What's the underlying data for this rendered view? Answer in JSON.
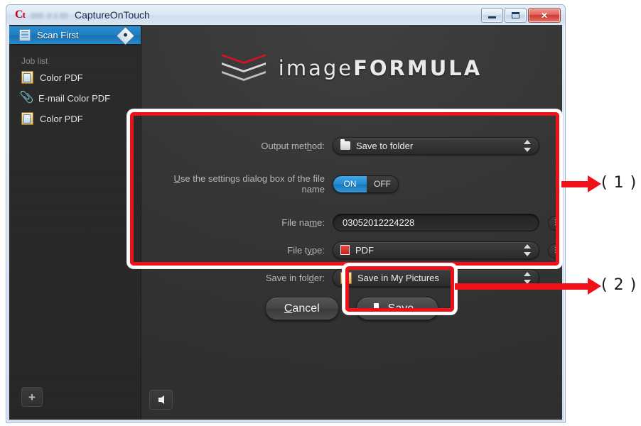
{
  "window": {
    "title": "CaptureOnTouch",
    "logo_mark": "canon-ct-logo",
    "controls": {
      "minimize": "minimize-button",
      "maximize": "maximize-button",
      "close": "close-button"
    }
  },
  "sidebar": {
    "scan_first": {
      "label": "Scan First",
      "icon": "document-scan-icon",
      "badge_icon": "start-diamond-icon"
    },
    "job_list_heading": "Job list",
    "jobs": [
      {
        "label": "Color PDF",
        "icon": "document-icon"
      },
      {
        "label": "E-mail Color PDF",
        "icon": "paperclip-icon"
      },
      {
        "label": "Color PDF",
        "icon": "document-icon"
      }
    ],
    "add_button_label": "+"
  },
  "main": {
    "brand": {
      "prefix": "image",
      "suffix": "FORMULA",
      "mark": "imageformula-chevron-logo"
    },
    "form": {
      "output_method": {
        "label_before": "Output met",
        "label_mnemonic": "h",
        "label_after": "od:",
        "value": "Save to folder",
        "icon": "folder-icon"
      },
      "use_settings_dialog": {
        "label_before": "",
        "label_mnemonic": "U",
        "label_after": "se the settings dialog box of the file name",
        "on_label": "ON",
        "off_label": "OFF",
        "state": "ON"
      },
      "file_name": {
        "label_before": "File na",
        "label_mnemonic": "m",
        "label_after": "e:",
        "value": "03052012224228",
        "mini_button_label": "⋮"
      },
      "file_type": {
        "label_before": "File t",
        "label_mnemonic": "y",
        "label_after": "pe:",
        "value": "PDF",
        "icon": "pdf-file-icon",
        "mini_button_label": "⋮"
      },
      "save_in_folder": {
        "label_before": "Save in fol",
        "label_mnemonic": "d",
        "label_after": "er:",
        "value": "Save in My Pictures",
        "icon": "pictures-folder-icon"
      }
    },
    "buttons": {
      "cancel": {
        "label_mnemonic": "C",
        "label_after": "ancel"
      },
      "save": {
        "label_mnemonic": "S",
        "label_after": "ave",
        "icon": "download-arrow-icon"
      }
    },
    "back_button_icon": "back-arrow-icon"
  },
  "annotations": [
    {
      "id": "1",
      "label": "( 1 )",
      "target": "settings-form-group"
    },
    {
      "id": "2",
      "label": "( 2 )",
      "target": "save-button"
    }
  ],
  "colors": {
    "accent_blue": "#2088cf",
    "annotation_red": "#f01018",
    "panel_dark": "#363636",
    "brand_red": "#c51f1f"
  }
}
